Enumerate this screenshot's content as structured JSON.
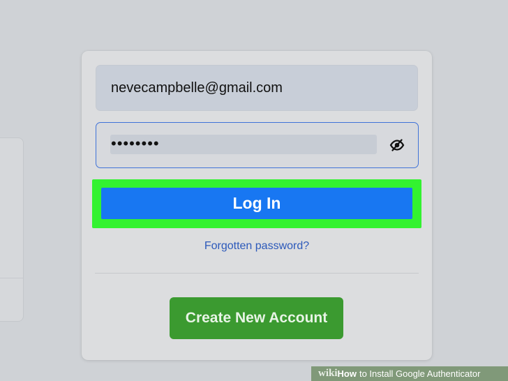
{
  "login_form": {
    "email_value": "nevecampbelle@gmail.com",
    "password_value": "••••••••",
    "password_toggle_icon": "eye-slash-icon",
    "login_label": "Log In",
    "forgot_password_label": "Forgotten password?",
    "create_account_label": "Create New Account"
  },
  "watermark": {
    "brand_prefix": "wiki",
    "brand_suffix": "How",
    "title": "to Install Google Authenticator"
  },
  "colors": {
    "login_button": "#1877f2",
    "highlight": "#33f230",
    "create_button": "#3b9a30",
    "link": "#2c59ba",
    "password_focus_border": "#3f72d8"
  }
}
